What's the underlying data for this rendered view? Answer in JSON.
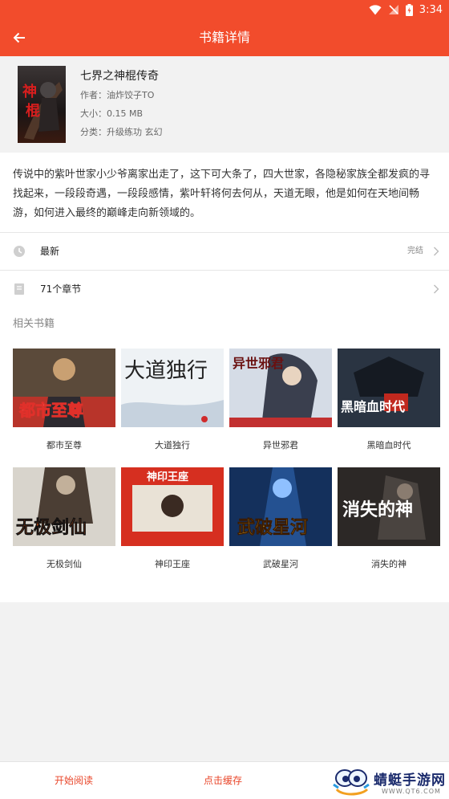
{
  "status_bar": {
    "time": "3:34"
  },
  "app_bar": {
    "title": "书籍详情"
  },
  "book": {
    "title": "七界之神棍传奇",
    "author": "作者：油炸饺子TO",
    "size": "大小：0.15 MB",
    "category": "分类：升级练功  玄幻",
    "cover_text": "神棍"
  },
  "description": "传说中的紫叶世家小少爷离家出走了，这下可大条了，四大世家，各隐秘家族全都发疯的寻找起来，一段段奇遇，一段段感情，紫叶轩将何去何从，天道无眼，他是如何在天地间畅游，如何进入最终的巅峰走向新领域的。",
  "rows": {
    "latest": {
      "label": "最新",
      "status": "完结"
    },
    "chapters": {
      "label": "71个章节"
    }
  },
  "related": {
    "title": "相关书籍",
    "books": [
      {
        "name": "都市至尊",
        "cover_text": "都市至尊",
        "color": "#c0392b"
      },
      {
        "name": "大道独行",
        "cover_text": "大道独行",
        "color": "#e8eef4"
      },
      {
        "name": "异世邪君",
        "cover_text": "异世邪君",
        "color": "#cfd8e6"
      },
      {
        "name": "黑暗血时代",
        "cover_text": "黑暗血时代",
        "color": "#1e2733"
      },
      {
        "name": "无极剑仙",
        "cover_text": "无极剑仙",
        "color": "#3a2e24"
      },
      {
        "name": "神印王座",
        "cover_text": "神印王座",
        "color": "#d62f20"
      },
      {
        "name": "武破星河",
        "cover_text": "武破星河",
        "color": "#13305c"
      },
      {
        "name": "消失的神",
        "cover_text": "消失的神",
        "color": "#2a2624"
      }
    ]
  },
  "bottom": {
    "start_reading": "开始阅读",
    "cache": "点击缓存"
  },
  "watermark": {
    "name": "蜻蜓手游网",
    "url": "WWW.QT6.COM"
  },
  "colors": {
    "accent": "#f24c2c",
    "bottom_text": "#e9462a"
  }
}
